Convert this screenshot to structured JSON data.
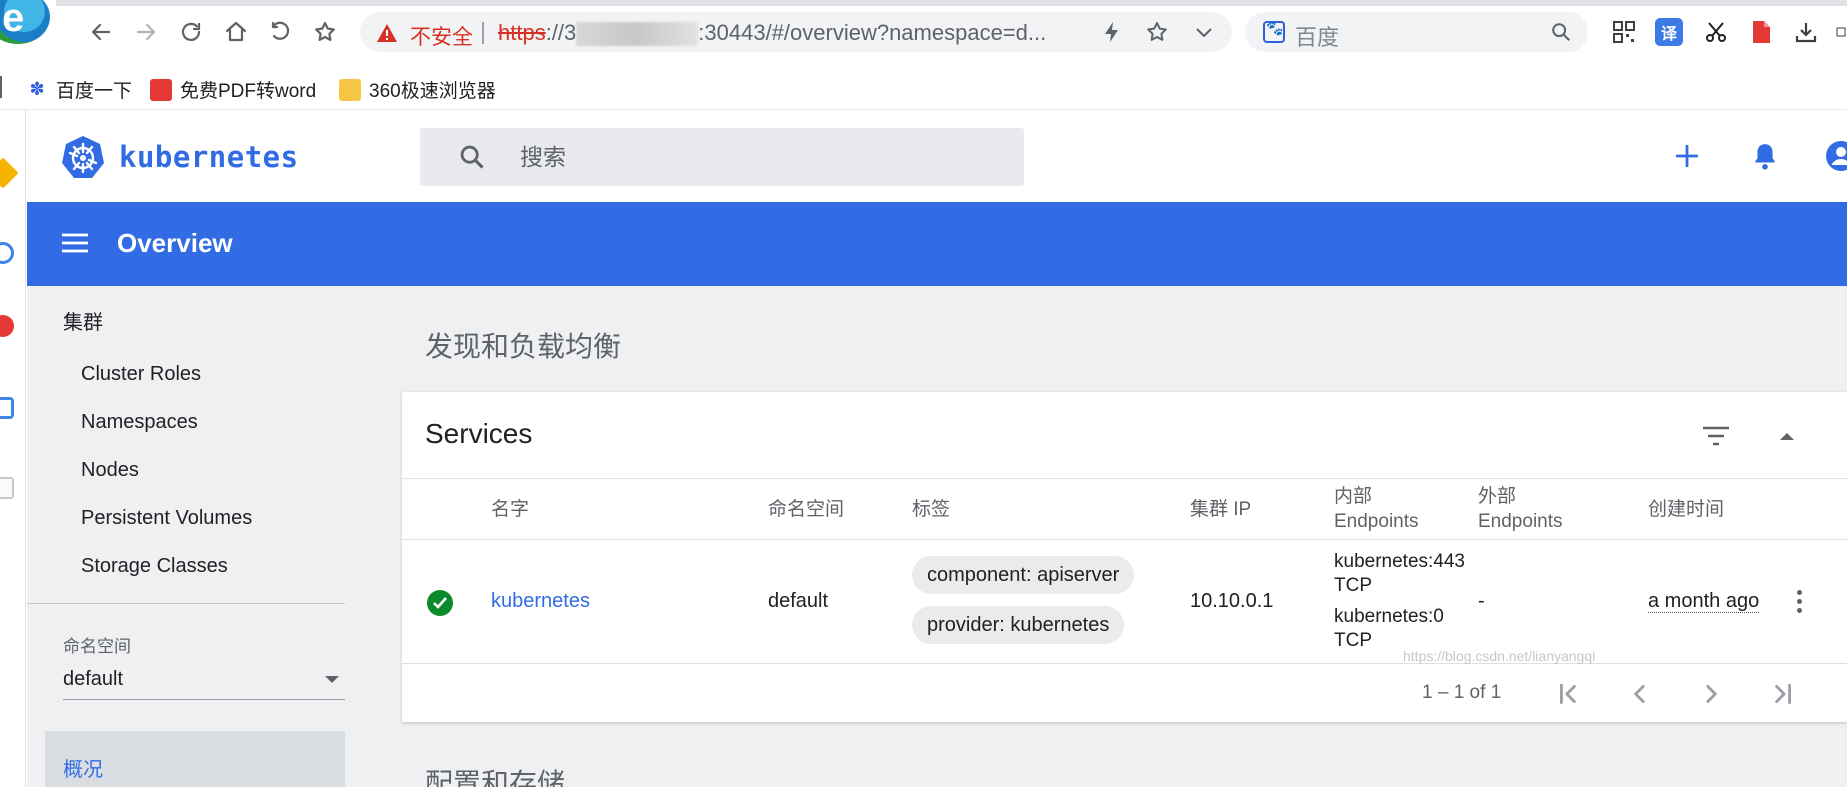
{
  "browser": {
    "insecure_label": "不安全",
    "url_scheme": "https",
    "url_prefix": "://3",
    "url_suffix": ":30443/#/overview?namespace=d...",
    "search_engine": "百度",
    "translate_label": "译"
  },
  "bookmarks": [
    {
      "label": "百度一下",
      "icon": "baidu-paw-icon"
    },
    {
      "label": "免费PDF转word",
      "icon": "pdf-icon"
    },
    {
      "label": "360极速浏览器",
      "icon": "folder-icon"
    }
  ],
  "app": {
    "brand": "kubernetes",
    "search_placeholder": "搜索",
    "page_title": "Overview"
  },
  "sidebar": {
    "cluster_heading": "集群",
    "items": [
      "Cluster Roles",
      "Namespaces",
      "Nodes",
      "Persistent Volumes",
      "Storage Classes"
    ],
    "namespace_label": "命名空间",
    "namespace_value": "default",
    "active_item": "概况"
  },
  "main": {
    "section_discovery": "发现和负载均衡",
    "section_config": "配置和存储",
    "services": {
      "title": "Services",
      "columns": {
        "name": "名字",
        "namespace": "命名空间",
        "labels": "标签",
        "cluster_ip": "集群 IP",
        "internal_endpoints_l1": "内部",
        "internal_endpoints_l2": "Endpoints",
        "external_endpoints_l1": "外部",
        "external_endpoints_l2": "Endpoints",
        "created": "创建时间"
      },
      "rows": [
        {
          "status": "ok",
          "name": "kubernetes",
          "namespace": "default",
          "labels": [
            "component: apiserver",
            "provider: kubernetes"
          ],
          "cluster_ip": "10.10.0.1",
          "internal_endpoints": [
            "kubernetes:443",
            "TCP",
            "kubernetes:0",
            "TCP"
          ],
          "external_endpoints": "-",
          "created": "a month ago"
        }
      ],
      "pagination": "1 – 1 of 1"
    }
  },
  "watermark": "https://blog.csdn.net/lianyangqi",
  "colors": {
    "brand_blue": "#326ce5",
    "status_green": "#0b8a2c",
    "warning_red": "#d93025"
  }
}
